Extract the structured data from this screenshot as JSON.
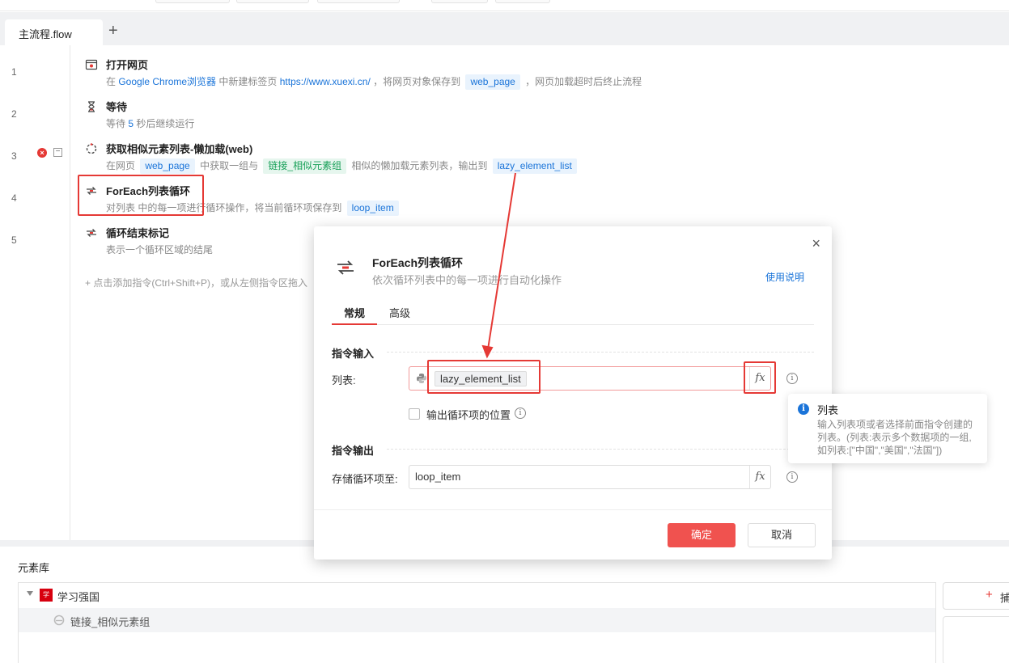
{
  "tabs": {
    "active_tab": "主流程.flow",
    "add_tab": "+"
  },
  "flow": {
    "lines": [
      "1",
      "2",
      "3",
      "4",
      "5"
    ],
    "cmd1": {
      "title": "打开网页",
      "p1": "在 ",
      "browser": "Google Chrome浏览器",
      "p2": " 中新建标签页 ",
      "url": "https://www.xuexi.cn/",
      "p3": " ，将网页对象保存到 ",
      "var": "web_page",
      "p4": " ，网页加载超时后终止流程"
    },
    "cmd2": {
      "title": "等待",
      "p1": "等待 ",
      "num": "5",
      "p2": " 秒后继续运行"
    },
    "cmd3": {
      "title": "获取相似元素列表-懒加载(web)",
      "p1": "在网页 ",
      "var1": "web_page",
      "p2": " 中获取一组与 ",
      "element": "链接_相似元素组",
      "p3": " 相似的懒加载元素列表，输出到 ",
      "var2": "lazy_element_list"
    },
    "cmd4": {
      "title": "ForEach列表循环",
      "p1": "对列表 中的每一项进行循环操作，将当前循环项保存到 ",
      "var": "loop_item"
    },
    "cmd5": {
      "title": "循环结束标记",
      "desc": "表示一个循环区域的结尾"
    },
    "add_hint": "+ 点击添加指令(Ctrl+Shift+P)，或从左侧指令区拖入"
  },
  "library": {
    "title": "元素库",
    "group": "学习强国",
    "item": "链接_相似元素组",
    "capture_plus": "+",
    "capture_label": "捕"
  },
  "dialog": {
    "close": "×",
    "title": "ForEach列表循环",
    "subtitle": "依次循环列表中的每一项进行自动化操作",
    "help": "使用说明",
    "tab_general": "常规",
    "tab_advanced": "高级",
    "input_section": "指令输入",
    "list_label": "列表:",
    "list_value": "lazy_element_list",
    "fx": "fx",
    "checkbox_label": "输出循环项的位置",
    "output_section": "指令输出",
    "store_label": "存储循环项至:",
    "store_value": "loop_item",
    "ok": "确定",
    "cancel": "取消"
  },
  "tooltip": {
    "title": "列表",
    "body": "输入列表项或者选择前面指令创建的列表。(列表:表示多个数据项的一组,如列表:[\"中国\",\"美国\",\"法国\"])"
  },
  "colors": {
    "accent_red": "#e53935",
    "link_blue": "#1a74d9",
    "ok_button": "#f0524f"
  }
}
